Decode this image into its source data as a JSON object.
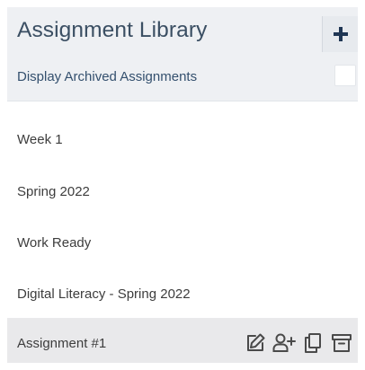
{
  "library": {
    "title": "Assignment Library",
    "add_button_icon": "plus-icon",
    "archived_toggle_label": "Display Archived Assignments",
    "archived_checked": false
  },
  "items": [
    {
      "label": "Week 1"
    },
    {
      "label": "Spring 2022"
    },
    {
      "label": "Work Ready"
    },
    {
      "label": "Digital Literacy - Spring 2022"
    },
    {
      "label": "Assignment #1",
      "selected": true
    }
  ],
  "item_actions": [
    "edit-icon",
    "assign-user-icon",
    "copy-icon",
    "archive-icon"
  ],
  "colors": {
    "header_bg": "#eef0f3",
    "title": "#3b4f63",
    "toggle_label": "#34506e",
    "plus_icon": "#1f3654",
    "selected_row_bg": "#e9e9eb",
    "item_text": "#3d3d3d",
    "action_icon": "#4a4a4a"
  }
}
